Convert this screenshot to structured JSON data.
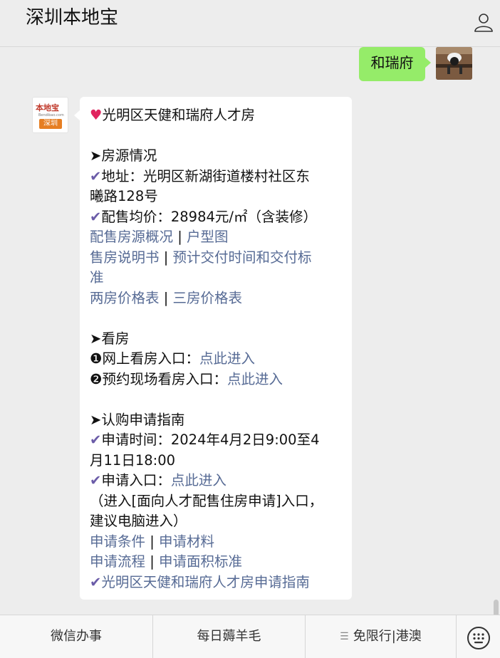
{
  "header": {
    "title": "深圳本地宝"
  },
  "outgoing": {
    "text": "和瑞府"
  },
  "bot_avatar": {
    "logo_text": "本地宝",
    "site": "Bendibao.com",
    "city": "深圳"
  },
  "message": {
    "title": "光明区天健和瑞府人才房",
    "sec1": "➤房源情况",
    "address_a": "地址：光明区新湖街道楼村社区东",
    "address_b": "曦路128号",
    "price": "配售均价：28984元/㎡（含装修）",
    "link_overview": "配售房源概况",
    "link_floorplan": "户型图",
    "link_manual": "售房说明书",
    "link_delivery_a": "预计交付时间和交付标",
    "link_delivery_b": "准",
    "link_two_room": "两房价格表",
    "link_three_room": "三房价格表",
    "sec2": "➤看房",
    "online_view": "❶网上看房入口：",
    "onsite_view": "❷预约现场看房入口：",
    "enter_here": "点此进入",
    "sec3": "➤认购申请指南",
    "time_a": "申请时间：2024年4月2日9:00至4",
    "time_b": "月11日18:00",
    "entry": "申请入口：",
    "note_a": "（进入[面向人才配售住房申请]入口，",
    "note_b": "建议电脑进入）",
    "link_conditions": "申请条件",
    "link_materials": "申请材料",
    "link_process": "申请流程",
    "link_area": "申请面积标准",
    "link_guide": "光明区天健和瑞府人才房申请指南",
    "separator": "|"
  },
  "bottom_menu": {
    "tab1": "微信办事",
    "tab2": "每日薅羊毛",
    "tab3": "免限行|港澳"
  },
  "icons": {
    "profile": "person-icon",
    "check": "check-icon",
    "heart": "heart-icon",
    "menu": "menu-lines-icon",
    "keyboard": "keyboard-icon"
  }
}
